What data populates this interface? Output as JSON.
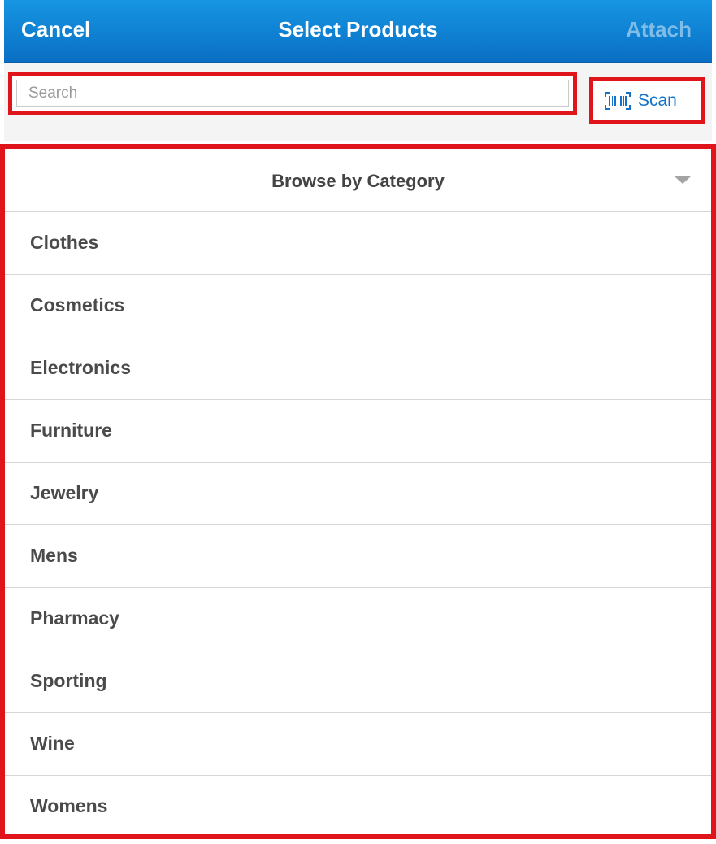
{
  "nav": {
    "cancel_label": "Cancel",
    "title": "Select Products",
    "attach_label": "Attach"
  },
  "search": {
    "placeholder": "Search",
    "value": ""
  },
  "scan": {
    "icon": "barcode-scan-icon",
    "label": "Scan"
  },
  "category": {
    "header_label": "Browse by Category",
    "items": [
      {
        "label": "Clothes"
      },
      {
        "label": "Cosmetics"
      },
      {
        "label": "Electronics"
      },
      {
        "label": "Furniture"
      },
      {
        "label": "Jewelry"
      },
      {
        "label": "Mens"
      },
      {
        "label": "Pharmacy"
      },
      {
        "label": "Sporting"
      },
      {
        "label": "Wine"
      },
      {
        "label": "Womens"
      }
    ]
  },
  "colors": {
    "navbar": "#0a84d6",
    "highlight": "#e0141b",
    "accent_link": "#1272c7"
  }
}
